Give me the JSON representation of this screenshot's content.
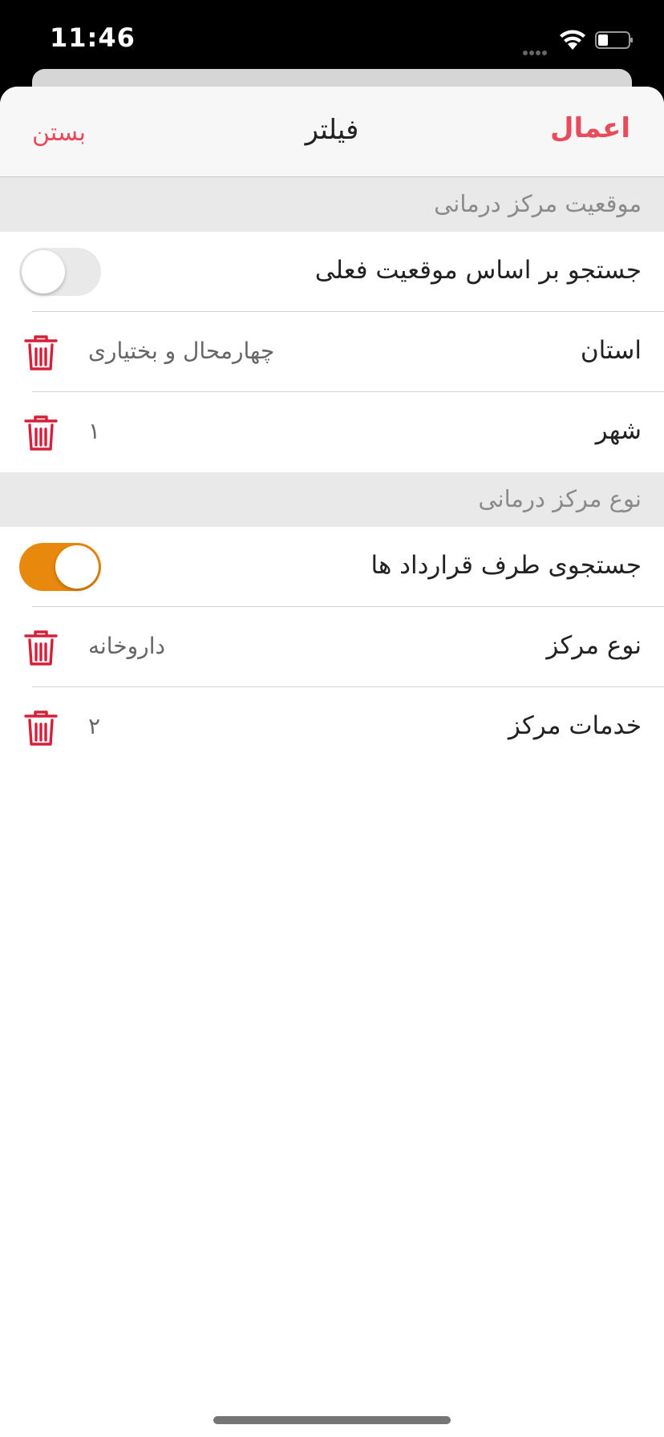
{
  "status_bar": {
    "time": "11:46"
  },
  "nav": {
    "title": "فیلتر",
    "apply_label": "اعمال",
    "close_label": "بستن"
  },
  "sections": [
    {
      "header": "موقعیت مرکز درمانی",
      "rows": [
        {
          "label": "جستجو بر اساس موقعیت فعلی",
          "toggle": "off"
        },
        {
          "label": "استان",
          "value": "چهارمحال و بختیاری"
        },
        {
          "label": "شهر",
          "value": "۱"
        }
      ]
    },
    {
      "header": "نوع مرکز درمانی",
      "rows": [
        {
          "label": "جستجوی طرف قرارداد ها",
          "toggle": "on"
        },
        {
          "label": "نوع مرکز",
          "value": "داروخانه"
        },
        {
          "label": "خدمات مرکز",
          "value": "۲"
        }
      ]
    }
  ],
  "colors": {
    "accent": "#e84b5a",
    "toggle_on": "#e8880c",
    "trash": "#d6203a"
  }
}
